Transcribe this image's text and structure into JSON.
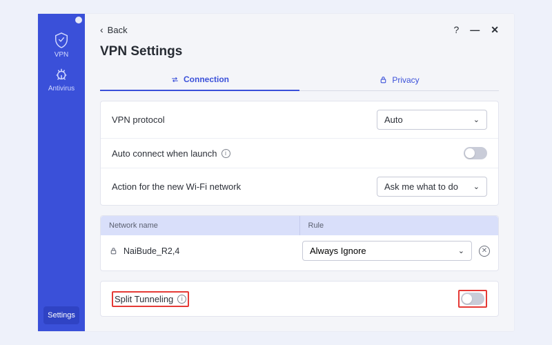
{
  "sidebar": {
    "items": [
      {
        "label": "VPN"
      },
      {
        "label": "Antivirus"
      }
    ],
    "settings_label": "Settings"
  },
  "header": {
    "back_label": "Back",
    "title": "VPN Settings"
  },
  "tabs": [
    {
      "label": "Connection"
    },
    {
      "label": "Privacy"
    }
  ],
  "settings": {
    "protocol_label": "VPN protocol",
    "protocol_value": "Auto",
    "autoconnect_label": "Auto connect when launch",
    "wifi_action_label": "Action for the new Wi-Fi network",
    "wifi_action_value": "Ask me what to do"
  },
  "network_table": {
    "head_name": "Network name",
    "head_rule": "Rule",
    "rows": [
      {
        "name": "NaiBude_R2,4",
        "rule": "Always Ignore"
      }
    ]
  },
  "split": {
    "label": "Split Tunneling"
  }
}
